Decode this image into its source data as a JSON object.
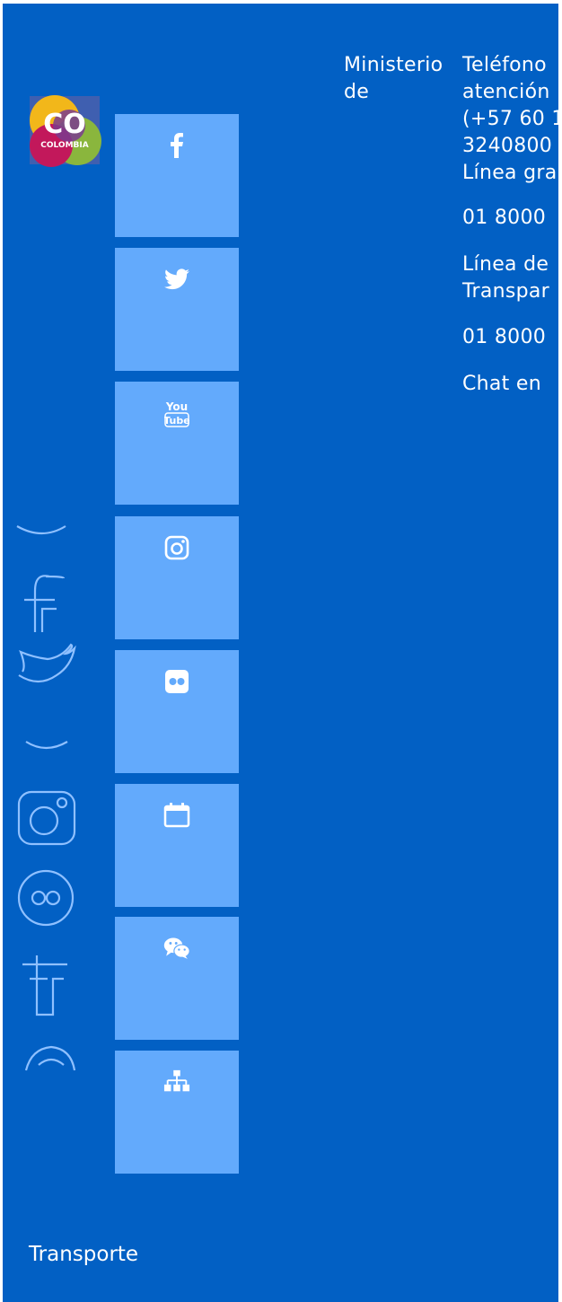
{
  "brand": {
    "logo_text": "CO",
    "logo_subtext": "COLOMBIA"
  },
  "social": [
    {
      "icon": "facebook-icon"
    },
    {
      "icon": "twitter-icon"
    },
    {
      "icon": "youtube-icon"
    },
    {
      "icon": "instagram-icon"
    },
    {
      "icon": "flickr-icon"
    },
    {
      "icon": "calendar-icon"
    },
    {
      "icon": "wechat-icon"
    },
    {
      "icon": "sitemap-icon"
    }
  ],
  "footer": {
    "ministry_line1": "Ministerio",
    "ministry_line2": "de",
    "ministry_line3": "Transporte",
    "phone_label_1": "Teléfono",
    "phone_label_2": "atención",
    "phone_label_3": "(+57 60 1",
    "phone_label_4": "3240800",
    "free_line_label": "Línea gra",
    "free_line_number": "01 8000",
    "transparency_label_1": "Línea de",
    "transparency_label_2": "Transpar",
    "transparency_number": "01 8000",
    "chat_label": "Chat en"
  },
  "colors": {
    "panel": "#0260c4",
    "tile": "#63aafc",
    "text": "#ffffff"
  }
}
